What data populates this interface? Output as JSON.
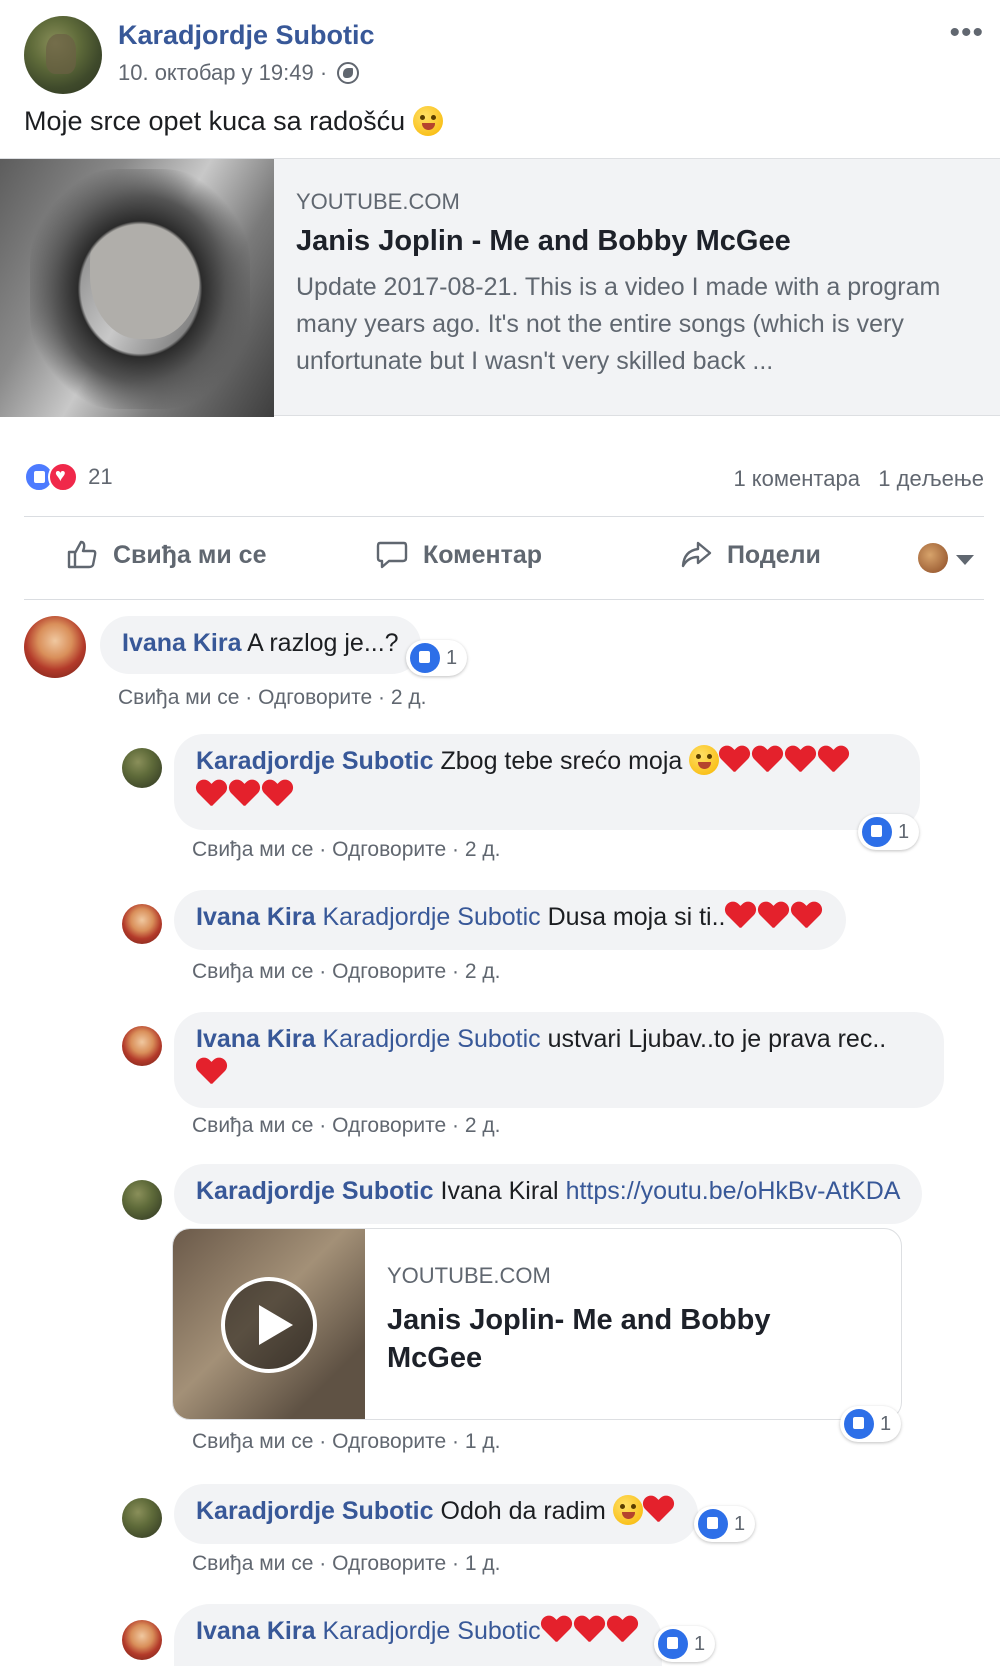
{
  "post": {
    "author": "Karadjordje Subotic",
    "date": "10. октобар у 19:49 ·",
    "text": "Moje srce opet kuca sa radošću",
    "more": "•••"
  },
  "link_card": {
    "domain": "YOUTUBE.COM",
    "title": "Janis Joplin - Me and Bobby McGee",
    "description": "Update 2017-08-21. This is a video I made with a program many years ago. It's not the entire songs (which is very unfortunate but I wasn't very skilled back ..."
  },
  "reactions": {
    "count": "21",
    "comments": "1 коментара",
    "shares": "1 дељење"
  },
  "actions": {
    "like": "Свиђа ми се",
    "comment": "Коментар",
    "share": "Подели"
  },
  "comment_actions": {
    "like": "Свиђа ми се",
    "reply": "Одговорите"
  },
  "comments": [
    {
      "author": "Ivana Kira",
      "text": "A razlog je...?",
      "time": "2 д.",
      "likes": "1"
    },
    {
      "author": "Karadjordje Subotic",
      "text": "Zbog tebe srećo moja",
      "time": "2 д.",
      "likes": "1"
    },
    {
      "author": "Ivana Kira",
      "mention": "Karadjordje Subotic",
      "text": "Dusa moja si ti..",
      "time": "2 д."
    },
    {
      "author": "Ivana Kira",
      "mention": "Karadjordje Subotic",
      "text": "ustvari Ljubav..to je prava rec..",
      "time": "2 д."
    },
    {
      "author": "Karadjordje Subotic",
      "text": "Ivana Kiral",
      "link": "https://youtu.be/oHkBv-AtKDA",
      "time": "1 д.",
      "likes": "1",
      "card": {
        "domain": "YOUTUBE.COM",
        "title": "Janis Joplin- Me and Bobby McGee"
      }
    },
    {
      "author": "Karadjordje Subotic",
      "text": "Odoh da radim",
      "time": "1 д.",
      "likes": "1"
    },
    {
      "author": "Ivana Kira",
      "mention": "Karadjordje Subotic",
      "likes": "1"
    }
  ],
  "icons": {
    "like": "thumbs-up-icon",
    "comment": "speech-bubble-icon",
    "share": "share-arrow-icon",
    "globe": "globe-icon",
    "play": "play-icon"
  },
  "colors": {
    "link": "#385898",
    "bubble": "#f2f3f5",
    "like_blue": "#2d6fe8",
    "heart_red": "#e4212c"
  }
}
